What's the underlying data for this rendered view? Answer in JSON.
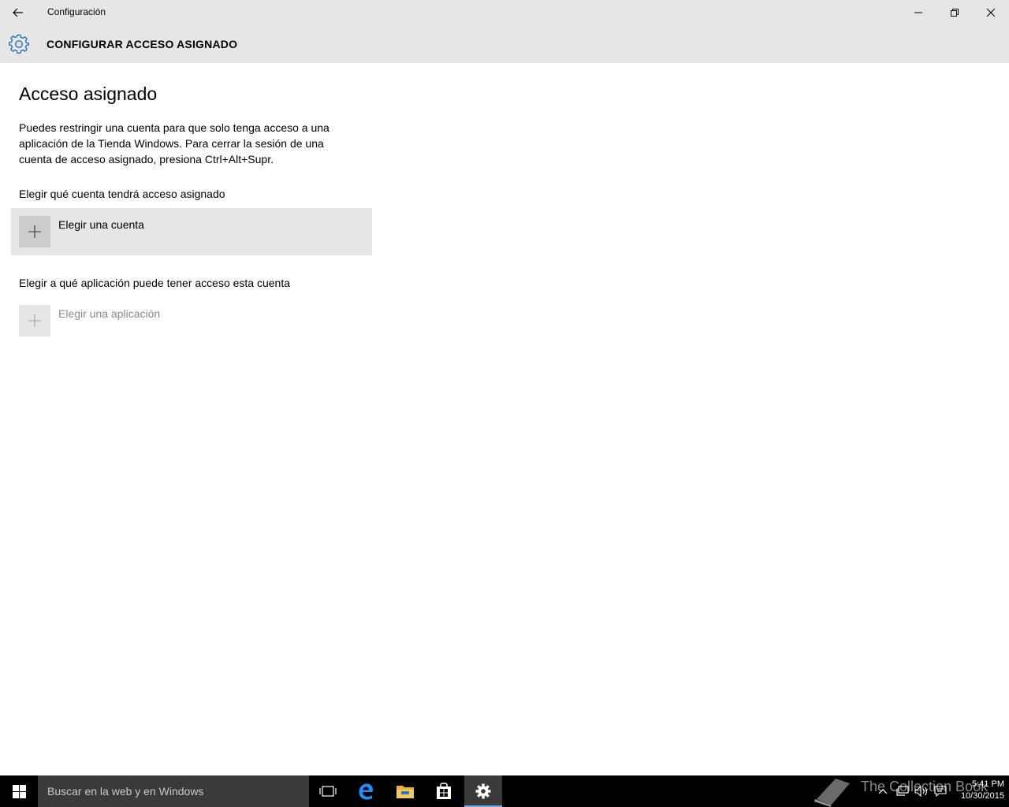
{
  "window": {
    "title": "Configuración"
  },
  "header": {
    "title": "CONFIGURAR ACCESO ASIGNADO"
  },
  "main": {
    "heading": "Acceso asignado",
    "description": "Puedes restringir una cuenta para que solo tenga acceso a una aplicación de la Tienda Windows. Para cerrar la sesión de una cuenta de acceso asignado, presiona Ctrl+Alt+Supr.",
    "account_section_label": "Elegir qué cuenta tendrá acceso asignado",
    "account_button_label": "Elegir una cuenta",
    "app_section_label": "Elegir a qué aplicación puede tener acceso esta cuenta",
    "app_button_label": "Elegir una aplicación"
  },
  "taskbar": {
    "search_placeholder": "Buscar en la web y en Windows",
    "apps": [
      "task-view-icon",
      "edge-icon",
      "file-explorer-icon",
      "store-icon",
      "settings-icon"
    ],
    "active_app": "settings-icon",
    "time": "5:41 PM",
    "date": "10/30/2015",
    "watermark": "The Collection Book"
  },
  "colors": {
    "chrome": "#e6e6e6",
    "accent": "#1e74c0",
    "taskbar": "#000000"
  }
}
